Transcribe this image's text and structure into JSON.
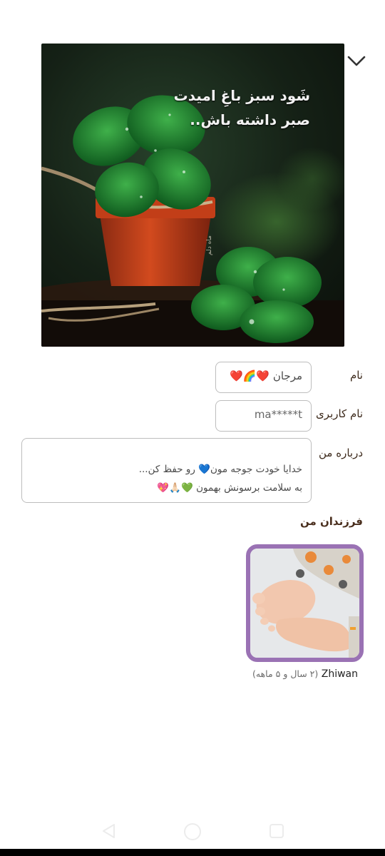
{
  "cover": {
    "caption_line1": "شَود سبز باغِ امیدت",
    "caption_line2": "صبر داشته باش..",
    "signature": "ماه دلم"
  },
  "profile": {
    "name_label": "نام",
    "name_value": "مرجان ❤️🌈❤️",
    "username_label": "نام کاربری",
    "username_value": "ma*****t",
    "about_label": "درباره من",
    "about_line1": "خدایا خودت جوجه مون💙 رو حفظ کن...",
    "about_line2": "به سلامت برسونش بهمون 💚🙏🏻💖"
  },
  "children": {
    "section_title": "فرزندان من",
    "items": [
      {
        "name": "Zhiwan",
        "age": "(۲ سال و ۵ ماهه)"
      }
    ]
  },
  "colors": {
    "child_frame": "#9a72b4",
    "label_text": "#3d2a1c"
  },
  "icons": {
    "collapse": "chevron-down-icon",
    "nav_back": "back-triangle-icon",
    "nav_home": "home-circle-icon",
    "nav_recents": "recents-square-icon"
  }
}
